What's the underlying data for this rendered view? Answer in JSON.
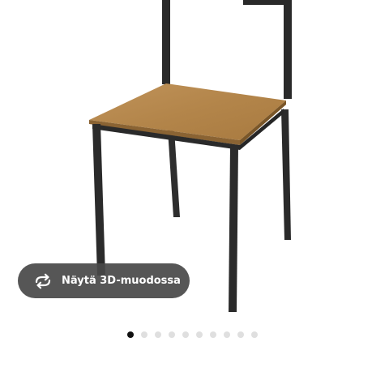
{
  "product_image": {
    "alt": "Chair with wooden seat and black metal frame"
  },
  "view3d_button": {
    "label": "Näytä 3D-muodossa",
    "icon": "rotate-3d-icon"
  },
  "pagination": {
    "total": 10,
    "active_index": 0
  },
  "colors": {
    "button_bg": "#484848",
    "dot_active": "#111111",
    "dot_inactive": "#dfdfdf",
    "seat_wood": "#b8894a",
    "frame_metal": "#2b2b2b"
  }
}
